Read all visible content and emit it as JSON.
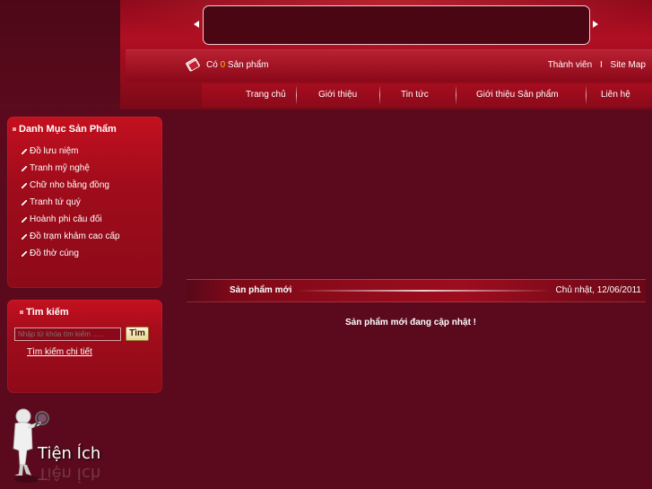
{
  "header": {
    "cart": {
      "prefix": "Có",
      "count": "0",
      "suffix": "Sản phẩm"
    },
    "member_link": "Thành viên",
    "separator": "I",
    "sitemap_link": "Site Map"
  },
  "nav": {
    "items": [
      {
        "label": "Trang chủ"
      },
      {
        "label": "Giới thiệu"
      },
      {
        "label": "Tin tức"
      },
      {
        "label": "Giới thiệu Sản phẩm"
      },
      {
        "label": "Liên hệ"
      }
    ]
  },
  "sidebar": {
    "categories": {
      "title": "Danh Mục Sản Phẩm",
      "items": [
        {
          "label": "Đồ lưu niệm"
        },
        {
          "label": "Tranh mỹ nghệ"
        },
        {
          "label": "Chữ nho bằng đồng"
        },
        {
          "label": "Tranh tứ quý"
        },
        {
          "label": "Hoành phi câu đối"
        },
        {
          "label": "Đồ trạm khảm cao cấp"
        },
        {
          "label": "Đồ thờ cúng"
        }
      ]
    },
    "search": {
      "title": "Tìm kiếm",
      "placeholder": "Nhập từ khóa tìm kiếm ......",
      "button_label": "Tìm",
      "advanced_link": "Tìm kiếm chi tiết"
    },
    "utilities_title": "Tiện Ích"
  },
  "main": {
    "new_products_title": "Sản phẩm mới",
    "date": "Chủ nhật, 12/06/2011",
    "updating_message": "Sản phẩm mới đang cập nhật !"
  },
  "colors": {
    "background": "#5a0a1c",
    "accent_red": "#b10f22",
    "cart_count": "#f5c400"
  }
}
